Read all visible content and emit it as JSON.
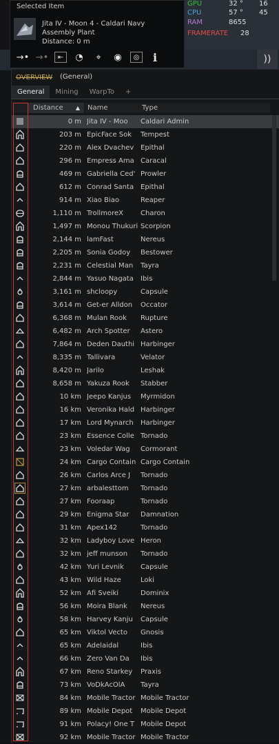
{
  "selected_item": {
    "title": "Selected Item",
    "name": "Jita IV - Moon 4 - Caldari Navy",
    "type": "Assembly Plant",
    "distance": "Distance: 0 m"
  },
  "perf": {
    "gpu_label": "GPU",
    "gpu_temp": "32 °",
    "gpu_load": "16",
    "cpu_label": "CPU",
    "cpu_temp": "57 °",
    "cpu_load": "45",
    "ram_label": "RAM",
    "ram_value": "8655",
    "fps_label": "FRAMERATE",
    "fps_value": "28"
  },
  "colors": {
    "gpu": "#35c23a",
    "cpu": "#4aa3e0",
    "ram": "#b47ad6",
    "fps": "#e04a4a",
    "highlight": "#d2332f"
  },
  "overview": {
    "title_strike": "OVERVIEW",
    "title_name": "(General)",
    "tabs": [
      "General",
      "Mining",
      "WarpTo",
      "+"
    ],
    "columns": {
      "distance": "Distance",
      "name": "Name",
      "type": "Type"
    },
    "rows": [
      {
        "icon": "station",
        "distance": "0 m",
        "name": "Jita IV - Moo",
        "type": "Caldari Admin"
      },
      {
        "icon": "battleship",
        "distance": "203 m",
        "name": "EpicFace Sok",
        "type": "Tempest"
      },
      {
        "icon": "cruiser",
        "distance": "220 m",
        "name": "Alex Dvachev",
        "type": "Epithal"
      },
      {
        "icon": "cruiser",
        "distance": "296 m",
        "name": "Empress Ama",
        "type": "Caracal"
      },
      {
        "icon": "industrial",
        "distance": "469 m",
        "name": "Gabriella Ced'",
        "type": "Prowler"
      },
      {
        "icon": "cruiser",
        "distance": "612 m",
        "name": "Conrad Santa",
        "type": "Epithal"
      },
      {
        "icon": "frigate",
        "distance": "914 m",
        "name": "Xiao Biao",
        "type": "Reaper"
      },
      {
        "icon": "freighter",
        "distance": "1,110 m",
        "name": "TrollmoreX",
        "type": "Charon"
      },
      {
        "icon": "battleship",
        "distance": "1,497 m",
        "name": "Monou Thukuri",
        "type": "Scorpion"
      },
      {
        "icon": "industrial",
        "distance": "2,144 m",
        "name": "lamFast",
        "type": "Nereus"
      },
      {
        "icon": "industrial",
        "distance": "2,205 m",
        "name": "Sonia Godoy",
        "type": "Bestower"
      },
      {
        "icon": "industrial",
        "distance": "2,231 m",
        "name": "Celestial Man",
        "type": "Tayra"
      },
      {
        "icon": "frigate",
        "distance": "2,844 m",
        "name": "Yasuo Nagata",
        "type": "Ibis"
      },
      {
        "icon": "capsule",
        "distance": "3,161 m",
        "name": "shcloopy",
        "type": "Capsule"
      },
      {
        "icon": "industrial",
        "distance": "3,614 m",
        "name": "Get-er Alldon",
        "type": "Occator"
      },
      {
        "icon": "cruiser",
        "distance": "6,368 m",
        "name": "Mulan Rook",
        "type": "Rupture"
      },
      {
        "icon": "frigate2",
        "distance": "6,482 m",
        "name": "Arch Spotter",
        "type": "Astero"
      },
      {
        "icon": "cruiser",
        "distance": "7,864 m",
        "name": "Deden Dauthi",
        "type": "Harbinger"
      },
      {
        "icon": "frigate",
        "distance": "8,335 m",
        "name": "Tallivara",
        "type": "Velator"
      },
      {
        "icon": "battleship",
        "distance": "8,420 m",
        "name": "Jarilo",
        "type": "Leshak"
      },
      {
        "icon": "cruiser",
        "distance": "8,658 m",
        "name": "Yakuza Rook",
        "type": "Stabber"
      },
      {
        "icon": "cruiser",
        "distance": "10 km",
        "name": "Jeepo Kanjus",
        "type": "Myrmidon"
      },
      {
        "icon": "cruiser",
        "distance": "16 km",
        "name": "Veronika Hald",
        "type": "Harbinger"
      },
      {
        "icon": "cruiser",
        "distance": "17 km",
        "name": "Lord Mynarch",
        "type": "Harbinger"
      },
      {
        "icon": "cruiser",
        "distance": "23 km",
        "name": "Essence Colle",
        "type": "Tornado"
      },
      {
        "icon": "frigate2",
        "distance": "23 km",
        "name": "Voledar Wag",
        "type": "Cormorant"
      },
      {
        "icon": "container",
        "distance": "24 km",
        "name": "Cargo Contain",
        "type": "Cargo Contain"
      },
      {
        "icon": "cruiser",
        "distance": "26 km",
        "name": "Carlos Arce J",
        "type": "Tornado"
      },
      {
        "icon": "cruiser-hl",
        "distance": "27 km",
        "name": "arbalesttom",
        "type": "Tornado"
      },
      {
        "icon": "cruiser",
        "distance": "27 km",
        "name": "Fooraap",
        "type": "Tornado"
      },
      {
        "icon": "cruiser",
        "distance": "29 km",
        "name": "Enigma Star",
        "type": "Damnation"
      },
      {
        "icon": "cruiser",
        "distance": "31 km",
        "name": "Apex142",
        "type": "Tornado"
      },
      {
        "icon": "frigate2",
        "distance": "32 km",
        "name": "Ladyboy Love",
        "type": "Heron"
      },
      {
        "icon": "cruiser",
        "distance": "32 km",
        "name": "jeff munson",
        "type": "Tornado"
      },
      {
        "icon": "capsule",
        "distance": "42 km",
        "name": "Yuri Levnik",
        "type": "Capsule"
      },
      {
        "icon": "cruiser",
        "distance": "43 km",
        "name": "Wild Haze",
        "type": "Loki"
      },
      {
        "icon": "battleship",
        "distance": "52 km",
        "name": "Afi Sveiki",
        "type": "Dominix"
      },
      {
        "icon": "industrial",
        "distance": "56 km",
        "name": "Moira Blank",
        "type": "Nereus"
      },
      {
        "icon": "capsule",
        "distance": "58 km",
        "name": "Harvey Kanju",
        "type": "Capsule"
      },
      {
        "icon": "cruiser",
        "distance": "65 km",
        "name": "Viktol Vecto",
        "type": "Gnosis"
      },
      {
        "icon": "frigate",
        "distance": "65 km",
        "name": "Adelaidal",
        "type": "Ibis"
      },
      {
        "icon": "frigate",
        "distance": "66 km",
        "name": "Zero Van Da",
        "type": "Ibis"
      },
      {
        "icon": "battleship",
        "distance": "67 km",
        "name": "Reno Starkey",
        "type": "Praxis"
      },
      {
        "icon": "industrial",
        "distance": "73 km",
        "name": "VoDkAcOlA",
        "type": "Tayra"
      },
      {
        "icon": "deployable",
        "distance": "84 km",
        "name": "Mobile Tractor",
        "type": "Mobile Tractor"
      },
      {
        "icon": "depot",
        "distance": "89 km",
        "name": "Mobile Depot",
        "type": "Mobile Depot"
      },
      {
        "icon": "depot",
        "distance": "91 km",
        "name": "Polacy! One T",
        "type": "Mobile Depot"
      },
      {
        "icon": "deployable",
        "distance": "92 km",
        "name": "Mobile Tractor",
        "type": "Mobile Tractor"
      }
    ]
  }
}
